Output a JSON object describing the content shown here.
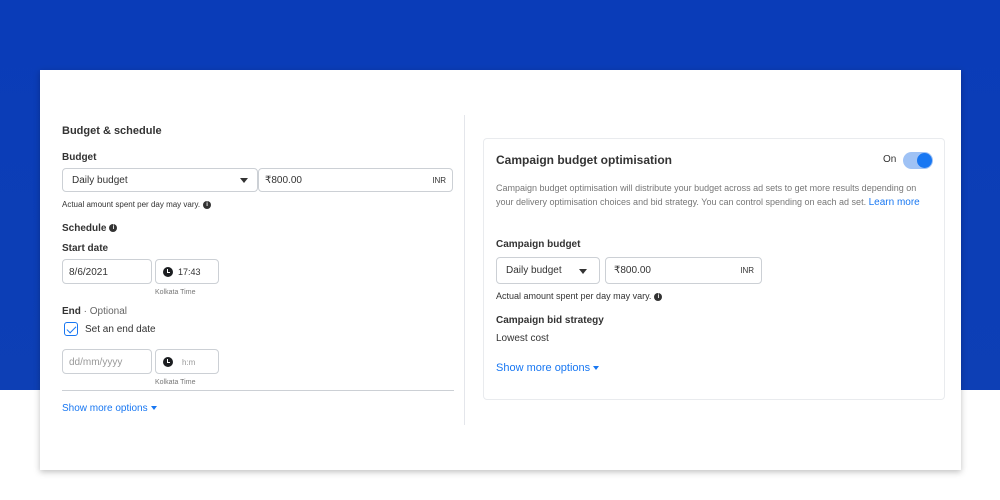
{
  "left_panel": {
    "title": "Budget & schedule",
    "budget_label": "Budget",
    "budget_type": "Daily budget",
    "budget_amount": "₹800.00",
    "currency": "INR",
    "budget_note": "Actual amount spent per day may vary.",
    "schedule_label": "Schedule",
    "start_date_label": "Start date",
    "start_date": "8/6/2021",
    "start_time": "17:43",
    "timezone": "Kolkata Time",
    "end_label": "End",
    "end_optional": " · Optional",
    "set_end_date_label": "Set an end date",
    "end_date_placeholder": "dd/mm/yyyy",
    "end_time_placeholder": "h:m",
    "end_timezone": "Kolkata Time",
    "show_more": "Show more options"
  },
  "right_panel": {
    "title": "Campaign budget optimisation",
    "toggle_label": "On",
    "toggle_on": true,
    "description": "Campaign budget optimisation will distribute your budget across ad sets to get more results depending on your delivery optimisation choices and bid strategy. You can control spending on each ad set.",
    "learn_more": "Learn more",
    "campaign_budget_label": "Campaign budget",
    "budget_type": "Daily budget",
    "budget_amount": "₹800.00",
    "currency": "INR",
    "budget_note": "Actual amount spent per day may vary.",
    "bid_strategy_label": "Campaign bid strategy",
    "bid_strategy_value": "Lowest cost",
    "show_more": "Show more options"
  },
  "colors": {
    "background_blue": "#0a3cb8",
    "accent": "#1877f2",
    "toggle_track": "#9fc2f5"
  }
}
